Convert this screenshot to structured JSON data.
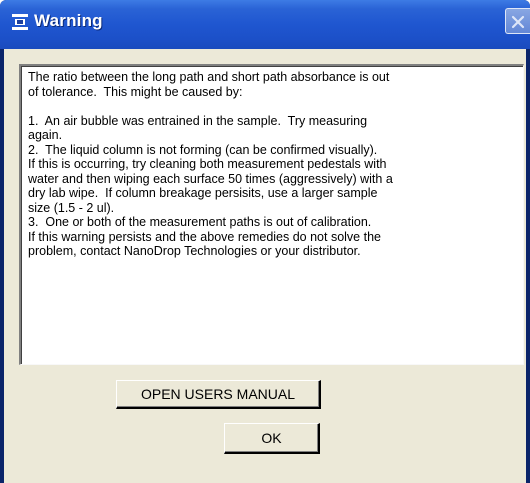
{
  "window": {
    "title": "Warning"
  },
  "icons": {
    "app": "nanodrop-app-icon",
    "close": "close-icon"
  },
  "colors": {
    "titlebar": "#1f56d0",
    "frame": "#0a246a",
    "client": "#ece9d8"
  },
  "message": {
    "lines": [
      "The ratio between the long path and short path absorbance is out",
      "of tolerance.  This might be caused by:",
      "",
      "1.  An air bubble was entrained in the sample.  Try measuring",
      "again.",
      "2.  The liquid column is not forming (can be confirmed visually).",
      "If this is occurring, try cleaning both measurement pedestals with",
      "water and then wiping each surface 50 times (aggressively) with a",
      "dry lab wipe.  If column breakage persisits, use a larger sample",
      "size (1.5 - 2 ul).",
      "3.  One or both of the measurement paths is out of calibration.",
      "If this warning persists and the above remedies do not solve the",
      "problem, contact NanoDrop Technologies or your distributor."
    ]
  },
  "buttons": {
    "open_manual_label": "OPEN USERS MANUAL",
    "ok_label": "OK"
  }
}
